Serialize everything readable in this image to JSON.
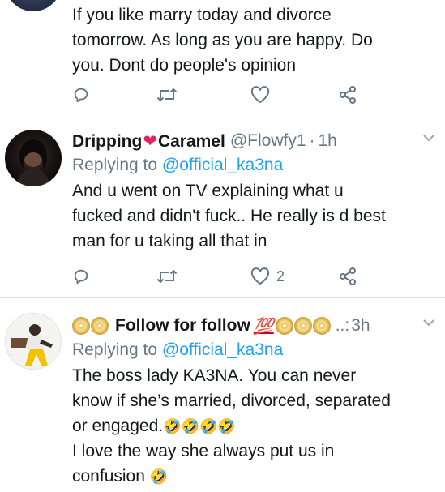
{
  "tweets": [
    {
      "text_lines": [
        "If you like marry today and divorce",
        "tomorrow. As long as you are happy. Do",
        "you. Dont do people's opinion"
      ],
      "like_count": ""
    },
    {
      "name_part1": "Dripping",
      "heart": "❤",
      "name_part2": "Caramel",
      "handle": "@Flowfy1",
      "dot": "·",
      "time": "1h",
      "replying_prefix": "Replying to",
      "replying_handle": "@official_ka3na",
      "text_lines": [
        "And u went on TV explaining what u",
        "fucked and didn't fuck.. He really is d best",
        "man for u taking all that in"
      ],
      "like_count": "2"
    },
    {
      "name": "Follow for follow",
      "hundred": "💯",
      "dots": "..:",
      "time": "3h",
      "replying_prefix": "Replying to",
      "replying_handle": "@official_ka3na",
      "text_lines": [
        "The boss lady KA3NA. You can never",
        "know if she’s married, divorced, separated",
        "or engaged.",
        "I love the way she always put us in",
        "confusion"
      ],
      "laugh_emoji": "🤣"
    }
  ],
  "icons": {
    "reply": "reply-icon",
    "retweet": "retweet-icon",
    "like": "heart-icon",
    "share": "share-icon",
    "caret": "chevron-down-icon"
  },
  "colors": {
    "link": "#1da1f2",
    "secondary": "#657786",
    "divider": "#d4dbe1"
  }
}
